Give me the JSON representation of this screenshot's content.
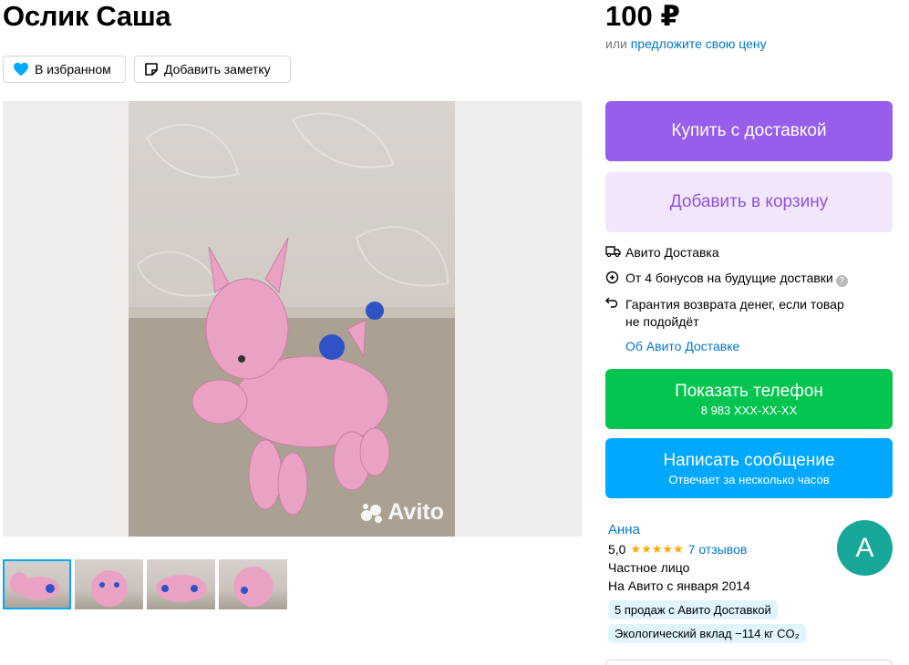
{
  "listing": {
    "title": "Ослик Саша",
    "price": "100 ₽",
    "offer_prefix": "или ",
    "offer_link": "предложите свою цену"
  },
  "actions": {
    "favorite_label": "В избранном",
    "note_label": "Добавить заметку"
  },
  "gallery": {
    "watermark": "Avito",
    "thumbnails_count": 4,
    "active_thumbnail": 1
  },
  "buttons": {
    "buy": "Купить с доставкой",
    "cart": "Добавить в корзину",
    "phone_main": "Показать телефон",
    "phone_sub": "8 983 XXX-XX-XX",
    "message_main": "Написать сообщение",
    "message_sub": "Отвечает за несколько часов"
  },
  "delivery": {
    "service": "Авито Доставка",
    "bonus": "От 4 бонусов на будущие доставки",
    "guarantee_line1": "Гарантия возврата денег, если товар",
    "guarantee_line2": "не подойдёт",
    "about_link": "Об Авито Доставке"
  },
  "seller": {
    "name": "Анна",
    "rating": "5,0",
    "stars": "★★★★★",
    "reviews": "7 отзывов",
    "type": "Частное лицо",
    "since": "На Авито с января 2014",
    "avatar_letter": "А",
    "badge_sales": "5 продаж с Авито Доставкой",
    "badge_eco": "Экологический вклад −114 кг CO₂"
  },
  "colors": {
    "buy": "#965eeb",
    "cart_bg": "#f2e6fd",
    "phone": "#02c54f",
    "message": "#00a8ff",
    "link": "#0077cc",
    "avatar": "#17a799"
  }
}
